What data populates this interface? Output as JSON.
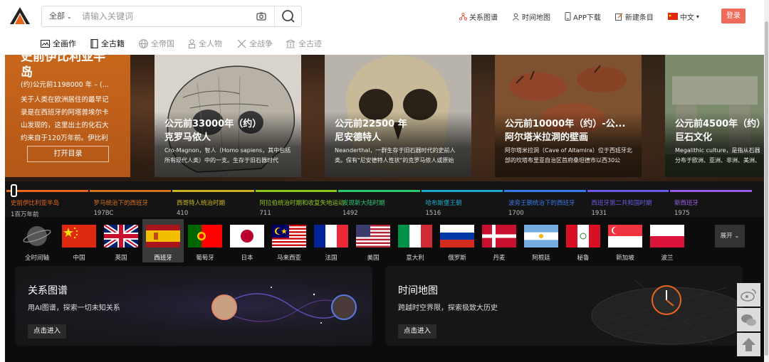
{
  "header": {
    "search_scope": "全部",
    "search_placeholder": "请输入关键词",
    "links": [
      {
        "icon": "network-icon",
        "label": "关系图谱"
      },
      {
        "icon": "person-pin-icon",
        "label": "时间地图"
      },
      {
        "icon": "phone-icon",
        "label": "APP下载"
      },
      {
        "icon": "edit-icon",
        "label": "新建条目"
      },
      {
        "icon": "china-flag-icon",
        "label": "中文"
      }
    ],
    "login_label": "登录"
  },
  "categories": [
    {
      "label": "全画作",
      "active": true,
      "icon": "painting-icon"
    },
    {
      "label": "全古籍",
      "active": true,
      "icon": "book-icon"
    },
    {
      "label": "全帝国",
      "active": false,
      "icon": "globe-icon"
    },
    {
      "label": "全人物",
      "active": false,
      "icon": "person-icon"
    },
    {
      "label": "全战争",
      "active": false,
      "icon": "swords-icon"
    },
    {
      "label": "全古迹",
      "active": false,
      "icon": "monument-icon"
    }
  ],
  "feature": {
    "title": "史前伊比利亚半岛",
    "date": "(约)公元前1198000 年 – (...",
    "description": "关于人类在欧洲居住的最早记录是在西班牙的阿塔普埃尔卡山发现的，这里出土的化石大约来自于120万年前。伊比利",
    "button_label": "打开目录"
  },
  "cards": [
    {
      "date": "公元前33000年（约）",
      "name": "克罗马侬人",
      "description": "Cro-Magnon，智人（Homo sapiens，其中包括所有现代人类）中的一支。生存于旧石器时代"
    },
    {
      "date": "公元前22500 年",
      "name": "尼安德特人",
      "description": "Neanderthal，一群生存于旧石器时代的史前人类。保有\"尼安德特人性状\"的克罗马侬人或原始"
    },
    {
      "date": "公元前10000年（约）-公...",
      "name": "阿尔塔米拉洞的壁画",
      "description": "阿尔塔米拉洞（Cave of Altamira）位于西班牙北部的坎塔布里亚自治区首府桑坦德市以西30公"
    },
    {
      "date": "公元前4500年（约）",
      "name": "巨石文化",
      "description": "Megalithic culture，是指从石器分布于欧洲、亚洲、非洲、美洲、"
    }
  ],
  "timeline": [
    {
      "name": "史前伊比利亚半岛",
      "year": "1百万年前",
      "color": "#e8651e"
    },
    {
      "name": "罗马统治下的西班牙",
      "year": "197BC",
      "color": "#d4741e"
    },
    {
      "name": "西哥特人统治时期",
      "year": "410",
      "color": "#c8b41e"
    },
    {
      "name": "阿拉伯统治时期和收复失地运动",
      "year": "711",
      "color": "#8cc81e"
    },
    {
      "name": "发现新大陆时期",
      "year": "1492",
      "color": "#2cc86e"
    },
    {
      "name": "哈布斯堡王朝",
      "year": "1516",
      "color": "#1ea8c8"
    },
    {
      "name": "波旁王朝统治下的西班牙",
      "year": "1700",
      "color": "#3a7ae8"
    },
    {
      "name": "西班牙第二共和国时期",
      "year": "1931",
      "color": "#6a5ae8"
    },
    {
      "name": "新西班牙",
      "year": "1975",
      "color": "#9a5ae8"
    }
  ],
  "countries": [
    {
      "name": "全时间轴",
      "flag": "globe"
    },
    {
      "name": "中国",
      "flag": "cn"
    },
    {
      "name": "英国",
      "flag": "gb"
    },
    {
      "name": "西班牙",
      "flag": "es",
      "selected": true
    },
    {
      "name": "葡萄牙",
      "flag": "pt"
    },
    {
      "name": "日本",
      "flag": "jp"
    },
    {
      "name": "马来西亚",
      "flag": "my"
    },
    {
      "name": "法国",
      "flag": "fr"
    },
    {
      "name": "美国",
      "flag": "us"
    },
    {
      "name": "意大利",
      "flag": "it"
    },
    {
      "name": "俄罗斯",
      "flag": "ru"
    },
    {
      "name": "丹麦",
      "flag": "dk"
    },
    {
      "name": "阿根廷",
      "flag": "ar"
    },
    {
      "name": "秘鲁",
      "flag": "pe"
    },
    {
      "name": "新加坡",
      "flag": "sg"
    },
    {
      "name": "波兰",
      "flag": "pl"
    }
  ],
  "expand_label": "展开",
  "panels": [
    {
      "title": "关系图谱",
      "description": "用AI图谱，探索一切未知关系",
      "button_label": "点击进入"
    },
    {
      "title": "时间地图",
      "description": "跨越时空界限，探索极致大历史",
      "button_label": "点击进入"
    }
  ],
  "floating": [
    "weibo-icon",
    "wechat-icon",
    "back-to-top-icon"
  ]
}
